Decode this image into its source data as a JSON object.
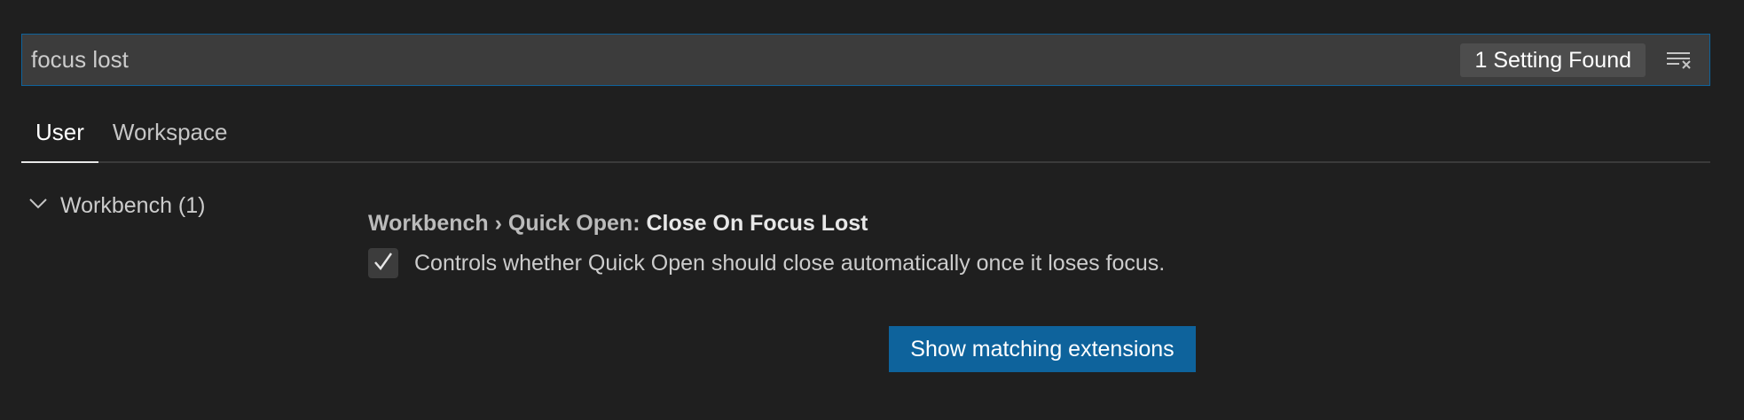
{
  "search": {
    "value": "focus lost",
    "result_count": "1 Setting Found",
    "clear_icon": "clear-filter-icon"
  },
  "tabs": [
    {
      "label": "User",
      "active": true
    },
    {
      "label": "Workspace",
      "active": false
    }
  ],
  "toc": {
    "items": [
      {
        "label": "Workbench (1)",
        "expanded": true,
        "icon": "chevron-down-icon"
      }
    ]
  },
  "setting": {
    "category": "Workbench › Quick Open: ",
    "name": "Close On Focus Lost",
    "description": "Controls whether Quick Open should close automatically once it loses focus.",
    "checked": true
  },
  "actions": {
    "show_extensions_label": "Show matching extensions"
  },
  "colors": {
    "background": "#1f1f1f",
    "accent": "#0e639c",
    "input_background": "#3c3c3c"
  }
}
